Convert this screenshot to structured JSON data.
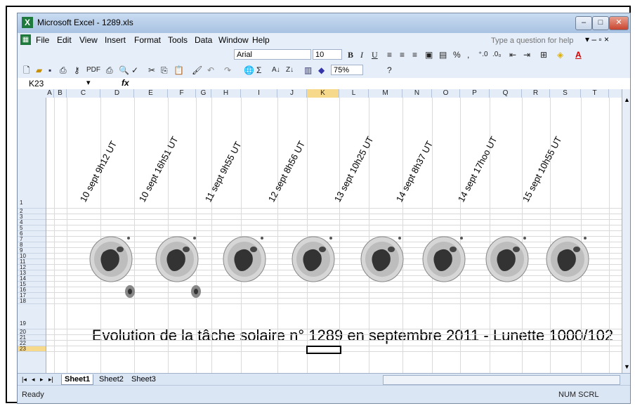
{
  "window": {
    "title": "Microsoft Excel - 1289.xls",
    "minimize": "–",
    "maximize": "□",
    "close": "✕"
  },
  "menu": {
    "items": [
      "File",
      "Edit",
      "View",
      "Insert",
      "Format",
      "Tools",
      "Data",
      "Window",
      "Help"
    ],
    "help_placeholder": "Type a question for help",
    "right_controls": "▾ – ▫ ×"
  },
  "toolbar": {
    "font_name": "Arial",
    "font_size": "10",
    "pdf_label": "PDF",
    "zoom": "75%",
    "bold": "B",
    "italic": "I",
    "underline": "U",
    "percent": "%",
    "comma": ",",
    "sum": "Σ"
  },
  "formula_bar": {
    "name_box": "K23",
    "fx": "fx"
  },
  "columns": [
    "A",
    "B",
    "C",
    "D",
    "E",
    "F",
    "G",
    "H",
    "I",
    "J",
    "K",
    "L",
    "M",
    "N",
    "O",
    "P",
    "Q",
    "R",
    "S",
    "T"
  ],
  "rows": [
    "1",
    "2",
    "3",
    "4",
    "5",
    "6",
    "7",
    "8",
    "9",
    "10",
    "11",
    "12",
    "13",
    "14",
    "15",
    "16",
    "17",
    "18",
    "19",
    "20",
    "21",
    "22",
    "23"
  ],
  "dates": [
    "10 sept 9h12 UT",
    "10 sept 16h51 UT",
    "11 sept 9h55 UT",
    "12 sept 8h56 UT",
    "13 sept 10h25 UT",
    "14 sept 8h37 UT",
    "14 sept 17hoo UT",
    "15 sept 10h55 UT"
  ],
  "caption": "Evolution de la tâche solaire n° 1289 en septembre 2011 - Lunette 1000/102",
  "sheets": [
    "Sheet1",
    "Sheet2",
    "Sheet3"
  ],
  "status": {
    "left": "Ready",
    "right": "NUM SCRL"
  },
  "colors": {
    "accent": "#1d7a3c",
    "chrome": "#dbe6f4"
  }
}
